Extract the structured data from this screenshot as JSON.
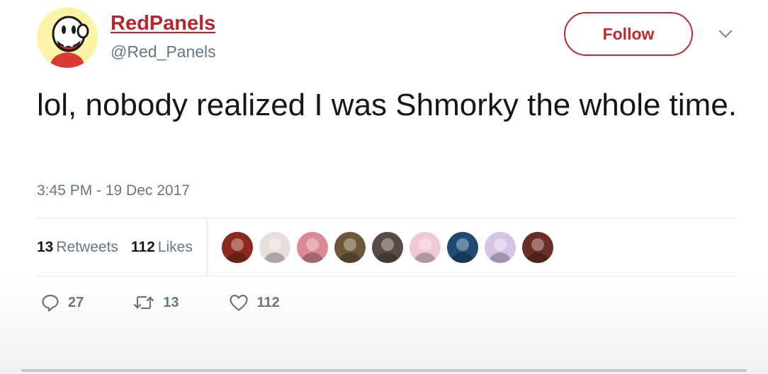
{
  "user": {
    "display_name": "RedPanels",
    "handle": "@Red_Panels"
  },
  "follow_button": {
    "label": "Follow"
  },
  "tweet": {
    "text": "lol, nobody realized I was Shmorky the whole time.",
    "timestamp": "3:45 PM - 19 Dec 2017"
  },
  "stats": {
    "retweets_count": "13",
    "retweets_label": "Retweets",
    "likes_count": "112",
    "likes_label": "Likes"
  },
  "likers": [
    {
      "color": "#8a2a1e"
    },
    {
      "color": "#e9dede"
    },
    {
      "color": "#d98a94"
    },
    {
      "color": "#6b5838"
    },
    {
      "color": "#5a4a44"
    },
    {
      "color": "#f0c9d4"
    },
    {
      "color": "#1e4a73"
    },
    {
      "color": "#d7c3e6"
    },
    {
      "color": "#6a2e26"
    }
  ],
  "actions": {
    "reply_count": "27",
    "retweet_count": "13",
    "like_count": "112"
  },
  "icons": {
    "reply": "reply-icon",
    "retweet": "retweet-icon",
    "like": "heart-icon",
    "caret": "chevron-down-icon"
  },
  "colors": {
    "brand_red": "#c0282e",
    "muted_text": "#657786",
    "text": "#14171a"
  }
}
